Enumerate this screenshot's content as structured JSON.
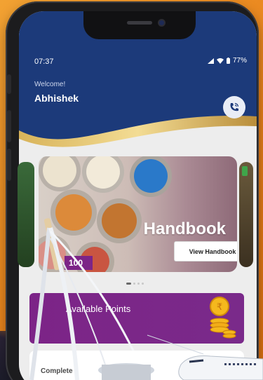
{
  "status_bar": {
    "time": "07:37",
    "battery": "77%"
  },
  "header": {
    "greeting": "Welcome!",
    "username": "Abhishek"
  },
  "icons": {
    "call": "phone-call-icon",
    "signal": "signal-icon",
    "wifi": "wifi-icon",
    "battery": "battery-icon",
    "coins": "rupee-coins-icon"
  },
  "banner": {
    "title": "Handbook",
    "button_label": "View Handbook",
    "badge": "100",
    "slide_count": 4,
    "active_slide": 1
  },
  "points_card": {
    "label": "Available Points"
  },
  "bottom_card": {
    "label": "Complete"
  },
  "colors": {
    "background": "#e8821b",
    "header": "#1c3a7a",
    "gold": "#c9a24a",
    "points": "#7c2487",
    "badge": "#7c2487"
  }
}
